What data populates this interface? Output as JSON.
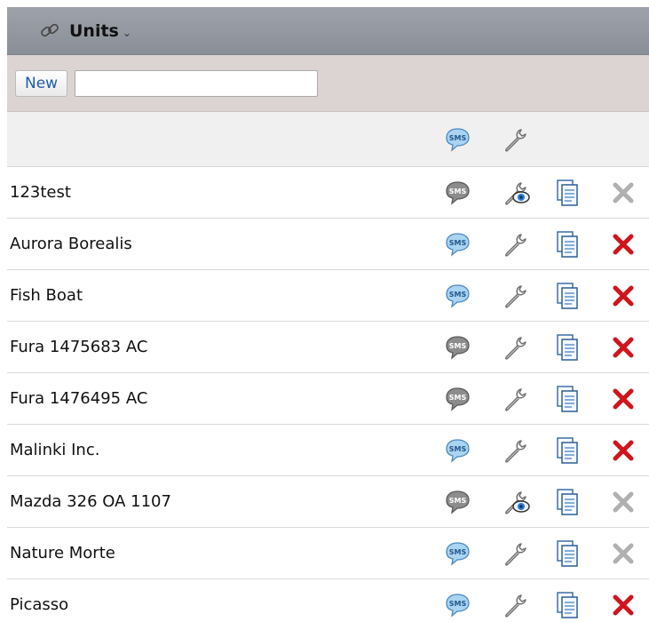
{
  "panel": {
    "title": "Units",
    "menu_caret": "⌄"
  },
  "toolbar": {
    "new_label": "New",
    "filter_value": "",
    "filter_placeholder": ""
  },
  "header": {
    "sms_icon": "sms-bubble-icon",
    "settings_icon": "wrench-icon"
  },
  "units": [
    {
      "name": "123test",
      "sms_active": false,
      "edit_icon": "eye-wrench-icon",
      "delete_enabled": false
    },
    {
      "name": "Aurora Borealis",
      "sms_active": true,
      "edit_icon": "wrench-icon",
      "delete_enabled": true
    },
    {
      "name": "Fish Boat",
      "sms_active": true,
      "edit_icon": "wrench-icon",
      "delete_enabled": true
    },
    {
      "name": "Fura 1475683 AC",
      "sms_active": false,
      "edit_icon": "wrench-icon",
      "delete_enabled": true
    },
    {
      "name": "Fura 1476495 AC",
      "sms_active": false,
      "edit_icon": "wrench-icon",
      "delete_enabled": true
    },
    {
      "name": "Malinki Inc.",
      "sms_active": true,
      "edit_icon": "wrench-icon",
      "delete_enabled": true
    },
    {
      "name": "Mazda 326 OA 1107",
      "sms_active": false,
      "edit_icon": "eye-wrench-icon",
      "delete_enabled": false
    },
    {
      "name": "Nature Morte",
      "sms_active": true,
      "edit_icon": "wrench-icon",
      "delete_enabled": false
    },
    {
      "name": "Picasso",
      "sms_active": true,
      "edit_icon": "wrench-icon",
      "delete_enabled": true
    }
  ],
  "colors": {
    "sms_active": "#a9d4f2",
    "sms_active_border": "#4a89c0",
    "sms_active_text": "#24578c",
    "sms_inactive": "#8c8c8c",
    "sms_inactive_border": "#5a5a5a",
    "delete_enabled": "#d0141c",
    "delete_disabled": "#b0b0b0",
    "link_text": "#1d5ea8"
  }
}
